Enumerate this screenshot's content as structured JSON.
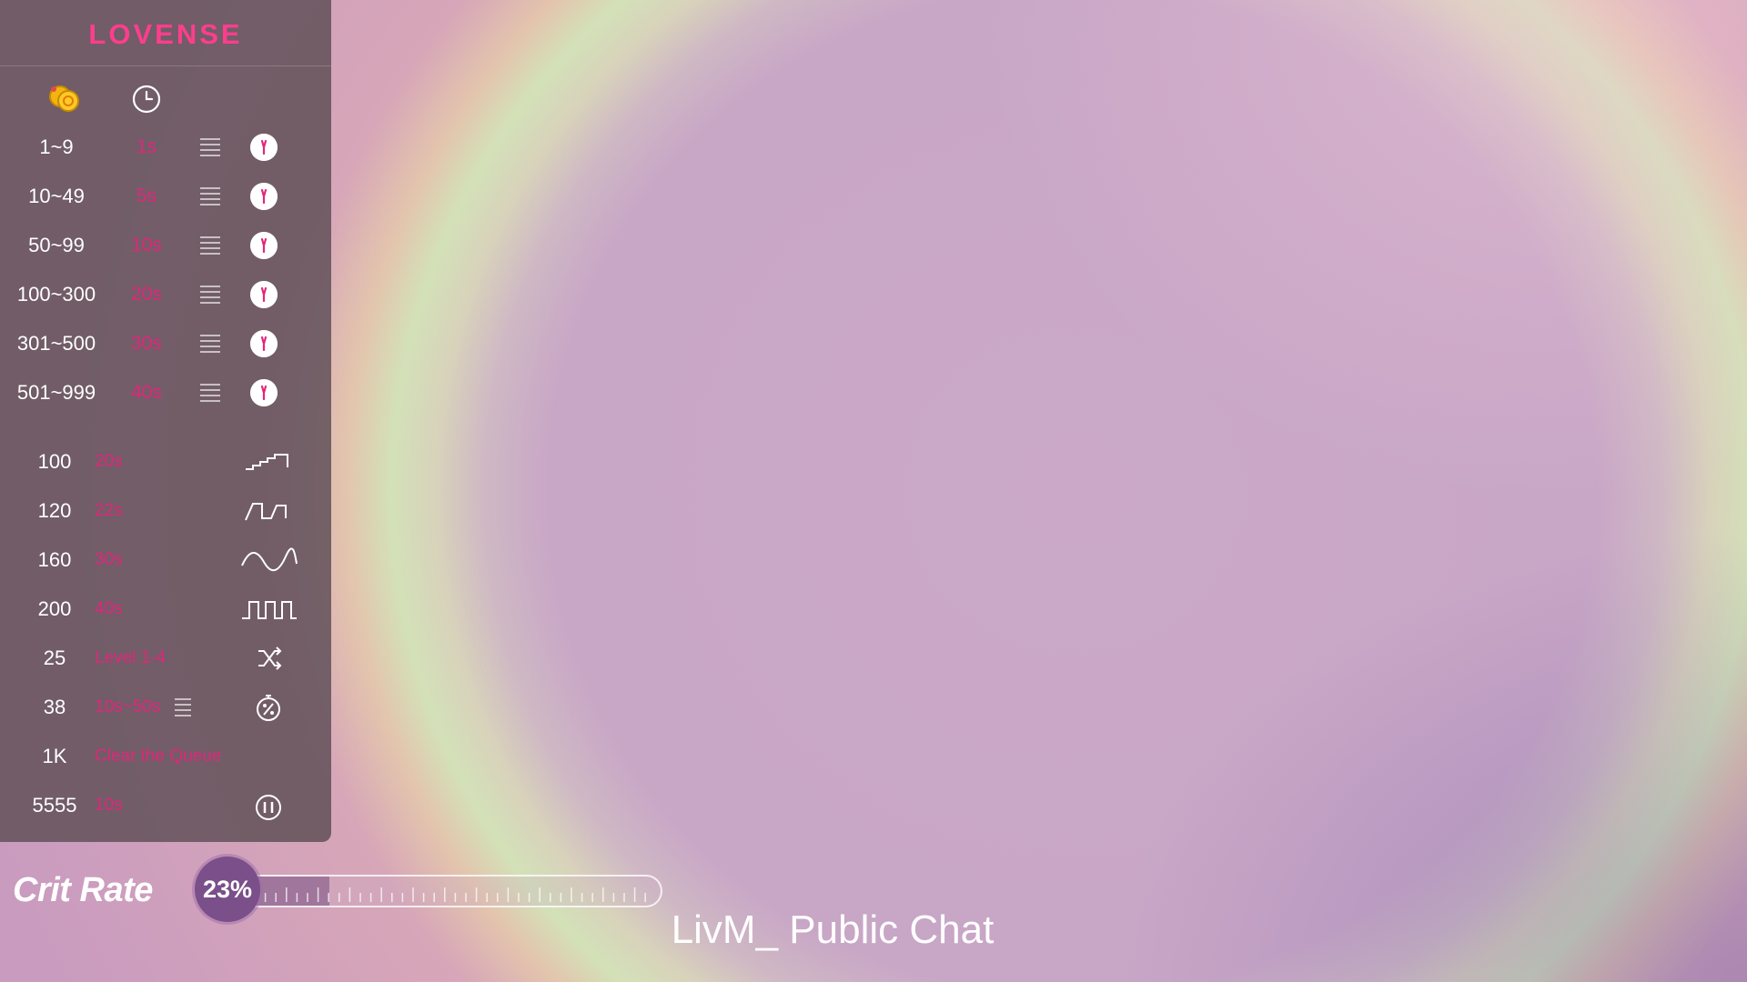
{
  "brand": {
    "logo_text": "LOVENSE"
  },
  "panel": {
    "header_icons": [
      "coins-icon",
      "clock-icon"
    ],
    "levels": [
      {
        "amount": "1~9",
        "duration": "1s",
        "icon": "vibration-icon"
      },
      {
        "amount": "10~49",
        "duration": "5s",
        "icon": "vibration-icon"
      },
      {
        "amount": "50~99",
        "duration": "10s",
        "icon": "vibration-icon"
      },
      {
        "amount": "100~300",
        "duration": "20s",
        "icon": "vibration-icon"
      },
      {
        "amount": "301~500",
        "duration": "30s",
        "icon": "vibration-icon"
      },
      {
        "amount": "501~999",
        "duration": "40s",
        "icon": "vibration-icon"
      }
    ],
    "specials": [
      {
        "amount": "100",
        "duration": "20s",
        "icon": "pattern-stairs-icon"
      },
      {
        "amount": "120",
        "duration": "22s",
        "icon": "pattern-pulse-icon"
      },
      {
        "amount": "160",
        "duration": "30s",
        "icon": "pattern-wave-icon"
      },
      {
        "amount": "200",
        "duration": "40s",
        "icon": "pattern-square-icon"
      },
      {
        "amount": "25",
        "duration": "Level 1-4",
        "icon": "shuffle-icon"
      },
      {
        "amount": "38",
        "duration": "10s~50s",
        "icon": "random-timer-icon"
      },
      {
        "amount": "1K",
        "duration": "Clear the Queue",
        "icon": ""
      },
      {
        "amount": "5555",
        "duration": "10s",
        "icon": "pause-icon"
      }
    ]
  },
  "crit": {
    "label": "Crit Rate",
    "percent_text": "23%",
    "percent": 0.23
  },
  "caption": "LivM_ Public Chat",
  "colors": {
    "accent": "#e0277a",
    "brand": "#ff3d8d",
    "panel": "#62525a"
  }
}
